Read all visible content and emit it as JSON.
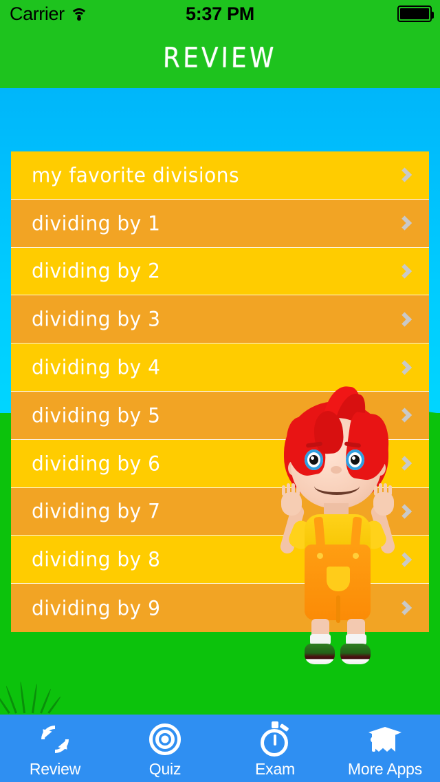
{
  "status_bar": {
    "carrier": "Carrier",
    "wifi_icon": "wifi-icon",
    "time": "5:37 PM",
    "battery_icon": "battery-full-icon"
  },
  "nav": {
    "title": "REVIEW",
    "bar_color": "#1ec31e"
  },
  "theme": {
    "sky": "#00ccff",
    "grass": "#12c212",
    "row_odd": "#ffcc00",
    "row_even": "#f2a424",
    "tabbar": "#2f8ff2",
    "chevron": "#c9c9c9",
    "row_text": "#ffffff"
  },
  "list": {
    "rows": [
      {
        "label": "my favorite divisions",
        "tone": "odd",
        "chevron": "chevron-right-icon"
      },
      {
        "label": "dividing by 1",
        "tone": "even",
        "chevron": "chevron-right-icon"
      },
      {
        "label": "dividing by 2",
        "tone": "odd",
        "chevron": "chevron-right-icon"
      },
      {
        "label": "dividing by 3",
        "tone": "even",
        "chevron": "chevron-right-icon"
      },
      {
        "label": "dividing by 4",
        "tone": "odd",
        "chevron": "chevron-right-icon"
      },
      {
        "label": "dividing by 5",
        "tone": "even",
        "chevron": "chevron-right-icon"
      },
      {
        "label": "dividing by 6",
        "tone": "odd",
        "chevron": "chevron-right-icon"
      },
      {
        "label": "dividing by 7",
        "tone": "even",
        "chevron": "chevron-right-icon"
      },
      {
        "label": "dividing by 8",
        "tone": "odd",
        "chevron": "chevron-right-icon"
      },
      {
        "label": "dividing by 9",
        "tone": "even",
        "chevron": "chevron-right-icon"
      }
    ]
  },
  "character": {
    "name": "cartoon-boy-mascot",
    "hair_color": "#e81414",
    "shirt_color": "#ffd21a",
    "overalls_color": "#ff9e12",
    "eye_color": "#2f9fe0"
  },
  "tabbar": {
    "tabs": [
      {
        "label": "Review",
        "icon": "refresh-icon",
        "selected": true
      },
      {
        "label": "Quiz",
        "icon": "target-icon",
        "selected": false
      },
      {
        "label": "Exam",
        "icon": "stopwatch-icon",
        "selected": false
      },
      {
        "label": "More Apps",
        "icon": "graduation-cap-icon",
        "selected": false
      }
    ]
  }
}
